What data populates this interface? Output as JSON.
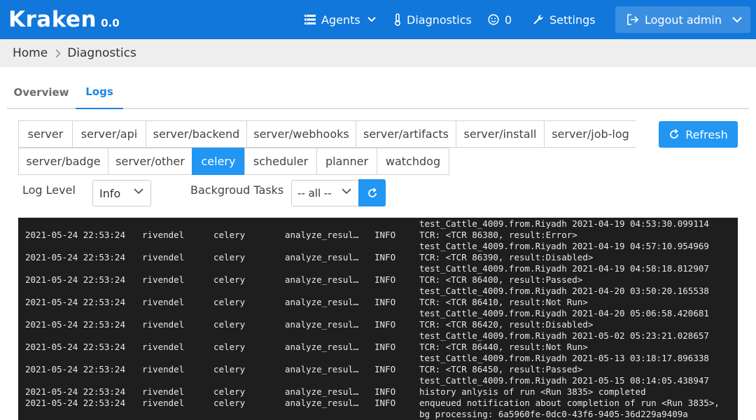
{
  "app": {
    "logo": "Kraken",
    "version": "0.0"
  },
  "nav": {
    "agents": "Agents",
    "diagnostics": "Diagnostics",
    "notifications_count": "0",
    "settings": "Settings",
    "logout": "Logout admin"
  },
  "breadcrumb": {
    "home": "Home",
    "current": "Diagnostics"
  },
  "tabs": {
    "overview": "Overview",
    "logs": "Logs",
    "active": "Logs"
  },
  "sources": {
    "row1": [
      "server",
      "server/api",
      "server/backend",
      "server/webhooks",
      "server/artifacts",
      "server/install",
      "server/job-log"
    ],
    "row2": [
      "server/badge",
      "server/other",
      "celery",
      "scheduler",
      "planner",
      "watchdog"
    ],
    "active": "celery"
  },
  "refresh_label": "Refresh",
  "filters": {
    "log_level_label": "Log Level",
    "log_level_value": "Info",
    "bg_tasks_label": "Backgroud Tasks",
    "bg_tasks_value": "-- all --"
  },
  "colors": {
    "navbar": "#1177db",
    "accent": "#2196f3",
    "log_bg": "#1e1e1e"
  },
  "logs": {
    "lines": [
      {
        "time": "",
        "host": "",
        "service": "",
        "tool": "",
        "level": "",
        "message": "test_Cattle_4009.from.Riyadh 2021-04-19 04:53:30.099114"
      },
      {
        "time": "2021-05-24 22:53:24",
        "host": "rivendel",
        "service": "celery",
        "tool": "analyze_results",
        "level": "INFO",
        "message": "TCR: <TCR 86380, result:Error>"
      },
      {
        "time": "",
        "host": "",
        "service": "",
        "tool": "",
        "level": "",
        "message": "test_Cattle_4009.from.Riyadh 2021-04-19 04:57:10.954969"
      },
      {
        "time": "2021-05-24 22:53:24",
        "host": "rivendel",
        "service": "celery",
        "tool": "analyze_results",
        "level": "INFO",
        "message": "TCR: <TCR 86390, result:Disabled>"
      },
      {
        "time": "",
        "host": "",
        "service": "",
        "tool": "",
        "level": "",
        "message": "test_Cattle_4009.from.Riyadh 2021-04-19 04:58:18.812907"
      },
      {
        "time": "2021-05-24 22:53:24",
        "host": "rivendel",
        "service": "celery",
        "tool": "analyze_results",
        "level": "INFO",
        "message": "TCR: <TCR 86400, result:Passed>"
      },
      {
        "time": "",
        "host": "",
        "service": "",
        "tool": "",
        "level": "",
        "message": "test_Cattle_4009.from.Riyadh 2021-04-20 03:50:20.165538"
      },
      {
        "time": "2021-05-24 22:53:24",
        "host": "rivendel",
        "service": "celery",
        "tool": "analyze_results",
        "level": "INFO",
        "message": "TCR: <TCR 86410, result:Not Run>"
      },
      {
        "time": "",
        "host": "",
        "service": "",
        "tool": "",
        "level": "",
        "message": "test_Cattle_4009.from.Riyadh 2021-04-20 05:06:58.420681"
      },
      {
        "time": "2021-05-24 22:53:24",
        "host": "rivendel",
        "service": "celery",
        "tool": "analyze_results",
        "level": "INFO",
        "message": "TCR: <TCR 86420, result:Disabled>"
      },
      {
        "time": "",
        "host": "",
        "service": "",
        "tool": "",
        "level": "",
        "message": "test_Cattle_4009.from.Riyadh 2021-05-02 05:23:21.028657"
      },
      {
        "time": "2021-05-24 22:53:24",
        "host": "rivendel",
        "service": "celery",
        "tool": "analyze_results",
        "level": "INFO",
        "message": "TCR: <TCR 86440, result:Not Run>"
      },
      {
        "time": "",
        "host": "",
        "service": "",
        "tool": "",
        "level": "",
        "message": "test_Cattle_4009.from.Riyadh 2021-05-13 03:18:17.896338"
      },
      {
        "time": "2021-05-24 22:53:24",
        "host": "rivendel",
        "service": "celery",
        "tool": "analyze_results",
        "level": "INFO",
        "message": "TCR: <TCR 86450, result:Passed>"
      },
      {
        "time": "",
        "host": "",
        "service": "",
        "tool": "",
        "level": "",
        "message": "test_Cattle_4009.from.Riyadh 2021-05-15 08:14:05.438947"
      },
      {
        "time": "2021-05-24 22:53:24",
        "host": "rivendel",
        "service": "celery",
        "tool": "analyze_results",
        "level": "INFO",
        "message": "history anlysis of run <Run 3835> completed"
      },
      {
        "time": "2021-05-24 22:53:24",
        "host": "rivendel",
        "service": "celery",
        "tool": "analyze_results",
        "level": "INFO",
        "message": "enqueued notification about completion of run <Run 3835>,"
      },
      {
        "time": "",
        "host": "",
        "service": "",
        "tool": "",
        "level": "",
        "message": "bg processing: 6a5960fe-0dc0-43f6-9405-36d229a9409a"
      }
    ]
  }
}
